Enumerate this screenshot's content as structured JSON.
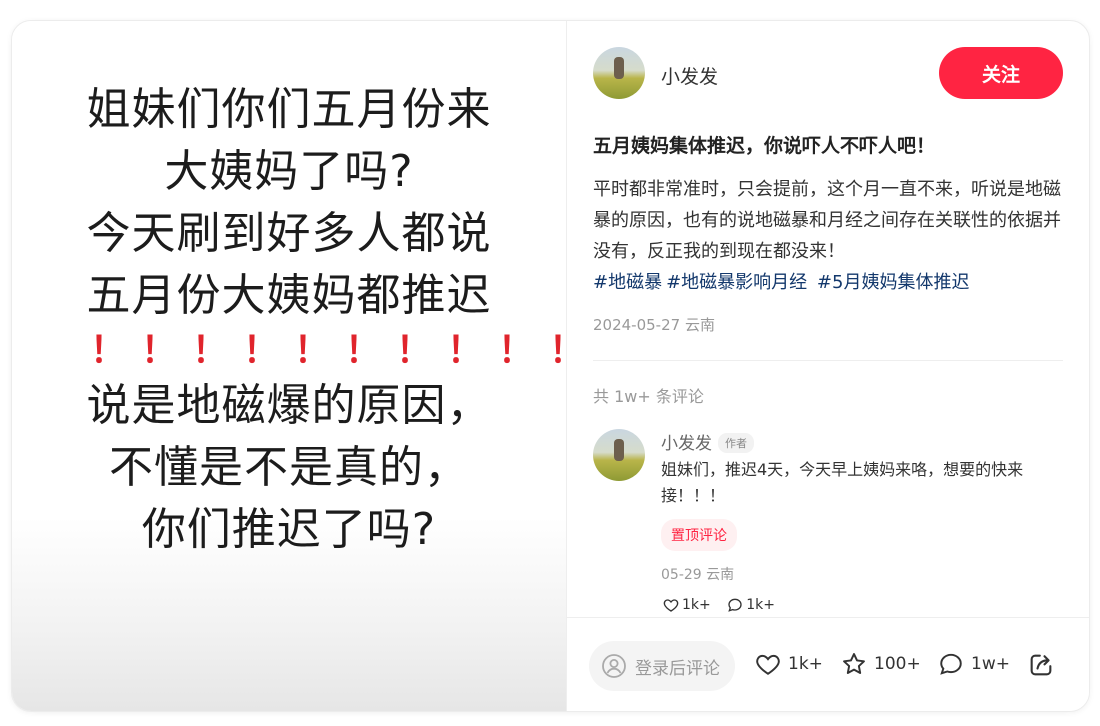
{
  "media": {
    "lines": [
      "姐妹们你们五月份来",
      "大姨妈了吗?",
      "今天刷到好多人都说",
      "五月份大姨妈都推迟",
      "！！！！！！！！！！",
      "说是地磁爆的原因，",
      "不懂是不是真的，",
      "你们推迟了吗?"
    ]
  },
  "author": {
    "name": "小发发",
    "follow_label": "关注"
  },
  "post": {
    "title": "五月姨妈集体推迟，你说吓人不吓人吧！",
    "body": "平时都非常准时，只会提前，这个月一直不来，听说是地磁暴的原因，也有的说地磁暴和月经之间存在关联性的依据并没有，反正我的到现在都没来！",
    "tags": [
      "#地磁暴",
      "#地磁暴影响月经",
      "#5月姨妈集体推迟"
    ],
    "meta": "2024-05-27 云南"
  },
  "comments": {
    "count_label": "共 1w+ 条评论",
    "items": [
      {
        "name": "小发发",
        "badge": "作者",
        "text": "姐妹们，推迟4天，今天早上姨妈来咯，想要的快来接！！！",
        "pin_label": "置顶评论",
        "meta": "05-29 云南",
        "likes": "1k+",
        "replies": "1k+"
      }
    ]
  },
  "bottom_bar": {
    "input_placeholder": "登录后评论",
    "likes": "1k+",
    "collects": "100+",
    "comments": "1w+"
  },
  "colors": {
    "accent": "#ff2442",
    "tag": "#13386c",
    "exclaim": "#e0242c"
  }
}
